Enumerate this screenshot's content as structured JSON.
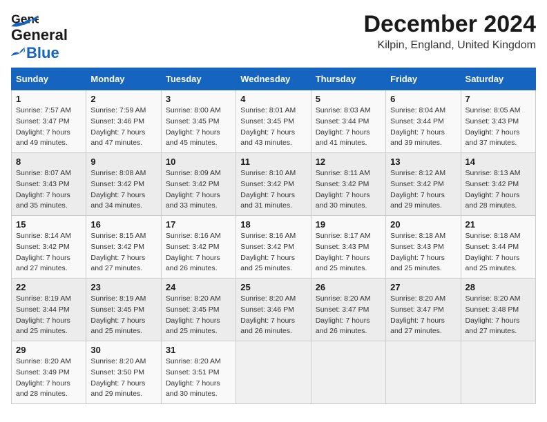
{
  "header": {
    "logo_line1": "General",
    "logo_line2": "Blue",
    "title": "December 2024",
    "subtitle": "Kilpin, England, United Kingdom"
  },
  "calendar": {
    "weekdays": [
      "Sunday",
      "Monday",
      "Tuesday",
      "Wednesday",
      "Thursday",
      "Friday",
      "Saturday"
    ],
    "weeks": [
      [
        null,
        null,
        {
          "day": 1,
          "sunrise": "Sunrise: 8:00 AM",
          "sunset": "Sunset: 3:45 PM",
          "daylight": "Daylight: 7 hours and 45 minutes."
        },
        {
          "day": 2,
          "sunrise": "Sunrise: 8:01 AM",
          "sunset": "Sunset: 3:45 PM",
          "daylight": "Daylight: 7 hours and 43 minutes."
        },
        {
          "day": 5,
          "sunrise": "Sunrise: 8:03 AM",
          "sunset": "Sunset: 3:44 PM",
          "daylight": "Daylight: 7 hours and 41 minutes."
        },
        {
          "day": 6,
          "sunrise": "Sunrise: 8:04 AM",
          "sunset": "Sunset: 3:44 PM",
          "daylight": "Daylight: 7 hours and 39 minutes."
        },
        {
          "day": 7,
          "sunrise": "Sunrise: 8:05 AM",
          "sunset": "Sunset: 3:43 PM",
          "daylight": "Daylight: 7 hours and 37 minutes."
        }
      ],
      [
        {
          "day": 1,
          "sunrise": "Sunrise: 7:57 AM",
          "sunset": "Sunset: 3:47 PM",
          "daylight": "Daylight: 7 hours and 49 minutes."
        },
        {
          "day": 2,
          "sunrise": "Sunrise: 7:59 AM",
          "sunset": "Sunset: 3:46 PM",
          "daylight": "Daylight: 7 hours and 47 minutes."
        },
        {
          "day": 3,
          "sunrise": "Sunrise: 8:00 AM",
          "sunset": "Sunset: 3:45 PM",
          "daylight": "Daylight: 7 hours and 45 minutes."
        },
        {
          "day": 4,
          "sunrise": "Sunrise: 8:01 AM",
          "sunset": "Sunset: 3:45 PM",
          "daylight": "Daylight: 7 hours and 43 minutes."
        },
        {
          "day": 5,
          "sunrise": "Sunrise: 8:03 AM",
          "sunset": "Sunset: 3:44 PM",
          "daylight": "Daylight: 7 hours and 41 minutes."
        },
        {
          "day": 6,
          "sunrise": "Sunrise: 8:04 AM",
          "sunset": "Sunset: 3:44 PM",
          "daylight": "Daylight: 7 hours and 39 minutes."
        },
        {
          "day": 7,
          "sunrise": "Sunrise: 8:05 AM",
          "sunset": "Sunset: 3:43 PM",
          "daylight": "Daylight: 7 hours and 37 minutes."
        }
      ],
      [
        {
          "day": 8,
          "sunrise": "Sunrise: 8:07 AM",
          "sunset": "Sunset: 3:43 PM",
          "daylight": "Daylight: 7 hours and 35 minutes."
        },
        {
          "day": 9,
          "sunrise": "Sunrise: 8:08 AM",
          "sunset": "Sunset: 3:42 PM",
          "daylight": "Daylight: 7 hours and 34 minutes."
        },
        {
          "day": 10,
          "sunrise": "Sunrise: 8:09 AM",
          "sunset": "Sunset: 3:42 PM",
          "daylight": "Daylight: 7 hours and 33 minutes."
        },
        {
          "day": 11,
          "sunrise": "Sunrise: 8:10 AM",
          "sunset": "Sunset: 3:42 PM",
          "daylight": "Daylight: 7 hours and 31 minutes."
        },
        {
          "day": 12,
          "sunrise": "Sunrise: 8:11 AM",
          "sunset": "Sunset: 3:42 PM",
          "daylight": "Daylight: 7 hours and 30 minutes."
        },
        {
          "day": 13,
          "sunrise": "Sunrise: 8:12 AM",
          "sunset": "Sunset: 3:42 PM",
          "daylight": "Daylight: 7 hours and 29 minutes."
        },
        {
          "day": 14,
          "sunrise": "Sunrise: 8:13 AM",
          "sunset": "Sunset: 3:42 PM",
          "daylight": "Daylight: 7 hours and 28 minutes."
        }
      ],
      [
        {
          "day": 15,
          "sunrise": "Sunrise: 8:14 AM",
          "sunset": "Sunset: 3:42 PM",
          "daylight": "Daylight: 7 hours and 27 minutes."
        },
        {
          "day": 16,
          "sunrise": "Sunrise: 8:15 AM",
          "sunset": "Sunset: 3:42 PM",
          "daylight": "Daylight: 7 hours and 27 minutes."
        },
        {
          "day": 17,
          "sunrise": "Sunrise: 8:16 AM",
          "sunset": "Sunset: 3:42 PM",
          "daylight": "Daylight: 7 hours and 26 minutes."
        },
        {
          "day": 18,
          "sunrise": "Sunrise: 8:16 AM",
          "sunset": "Sunset: 3:42 PM",
          "daylight": "Daylight: 7 hours and 25 minutes."
        },
        {
          "day": 19,
          "sunrise": "Sunrise: 8:17 AM",
          "sunset": "Sunset: 3:43 PM",
          "daylight": "Daylight: 7 hours and 25 minutes."
        },
        {
          "day": 20,
          "sunrise": "Sunrise: 8:18 AM",
          "sunset": "Sunset: 3:43 PM",
          "daylight": "Daylight: 7 hours and 25 minutes."
        },
        {
          "day": 21,
          "sunrise": "Sunrise: 8:18 AM",
          "sunset": "Sunset: 3:44 PM",
          "daylight": "Daylight: 7 hours and 25 minutes."
        }
      ],
      [
        {
          "day": 22,
          "sunrise": "Sunrise: 8:19 AM",
          "sunset": "Sunset: 3:44 PM",
          "daylight": "Daylight: 7 hours and 25 minutes."
        },
        {
          "day": 23,
          "sunrise": "Sunrise: 8:19 AM",
          "sunset": "Sunset: 3:45 PM",
          "daylight": "Daylight: 7 hours and 25 minutes."
        },
        {
          "day": 24,
          "sunrise": "Sunrise: 8:20 AM",
          "sunset": "Sunset: 3:45 PM",
          "daylight": "Daylight: 7 hours and 25 minutes."
        },
        {
          "day": 25,
          "sunrise": "Sunrise: 8:20 AM",
          "sunset": "Sunset: 3:46 PM",
          "daylight": "Daylight: 7 hours and 26 minutes."
        },
        {
          "day": 26,
          "sunrise": "Sunrise: 8:20 AM",
          "sunset": "Sunset: 3:47 PM",
          "daylight": "Daylight: 7 hours and 26 minutes."
        },
        {
          "day": 27,
          "sunrise": "Sunrise: 8:20 AM",
          "sunset": "Sunset: 3:47 PM",
          "daylight": "Daylight: 7 hours and 27 minutes."
        },
        {
          "day": 28,
          "sunrise": "Sunrise: 8:20 AM",
          "sunset": "Sunset: 3:48 PM",
          "daylight": "Daylight: 7 hours and 27 minutes."
        }
      ],
      [
        {
          "day": 29,
          "sunrise": "Sunrise: 8:20 AM",
          "sunset": "Sunset: 3:49 PM",
          "daylight": "Daylight: 7 hours and 28 minutes."
        },
        {
          "day": 30,
          "sunrise": "Sunrise: 8:20 AM",
          "sunset": "Sunset: 3:50 PM",
          "daylight": "Daylight: 7 hours and 29 minutes."
        },
        {
          "day": 31,
          "sunrise": "Sunrise: 8:20 AM",
          "sunset": "Sunset: 3:51 PM",
          "daylight": "Daylight: 7 hours and 30 minutes."
        },
        null,
        null,
        null,
        null
      ]
    ]
  }
}
